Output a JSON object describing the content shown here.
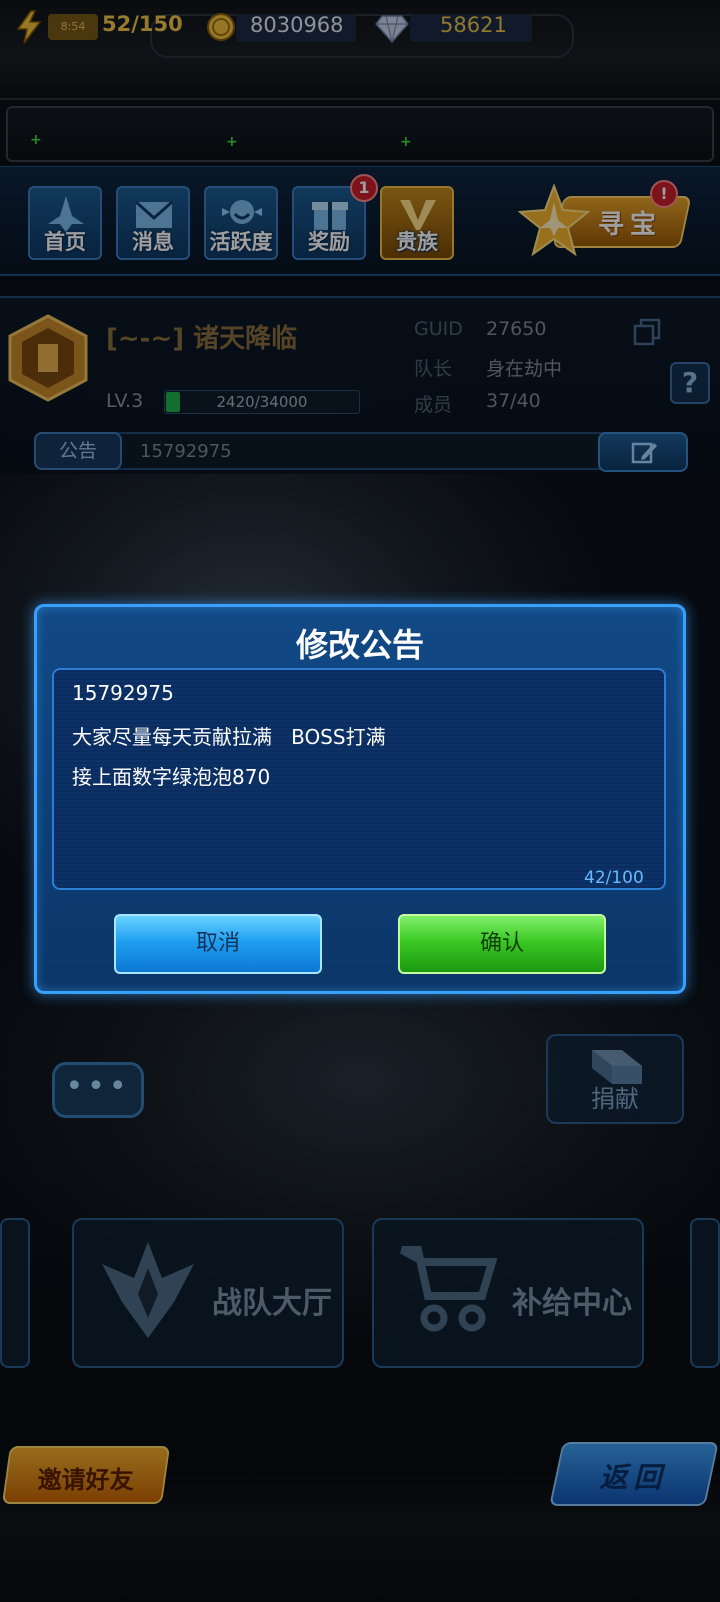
{
  "resources": {
    "energy_timer": "8:54",
    "energy": "52/150",
    "coins": "8030968",
    "gems": "58621"
  },
  "nav": {
    "items": [
      {
        "label": "首页"
      },
      {
        "label": "消息"
      },
      {
        "label": "活跃度"
      },
      {
        "label": "奖励",
        "badge": "1"
      },
      {
        "label": "贵族"
      }
    ],
    "treasure": {
      "label": "寻宝",
      "badge": "!"
    }
  },
  "team": {
    "name": "[~-~] 诸天降临",
    "level": "LV.3",
    "xp_text": "2420/34000",
    "xp_progress": 0.0712,
    "guid_label": "GUID",
    "guid": "27650",
    "leader_label": "队长",
    "leader": "身在劫中",
    "members_label": "成员",
    "members": "37/40",
    "help": "?",
    "notice_tag": "公告",
    "notice": "15792975"
  },
  "floor": {
    "chat": "•••",
    "donate": "捐献",
    "hall": "战队大厅",
    "supply": "补给中心",
    "invite": "邀请好友",
    "back": "返回"
  },
  "modal": {
    "title": "修改公告",
    "lines": [
      "15792975",
      "大家尽量每天贡献拉满   BOSS打满",
      "接上面数字绿泡泡870"
    ],
    "counter": "42/100",
    "cancel": "取消",
    "confirm": "确认"
  },
  "colors": {
    "modal_border": "#3aa0ff",
    "cancel_button": "#1f9ff0",
    "confirm_button": "#3bc824",
    "gold": "#f2c64a"
  }
}
